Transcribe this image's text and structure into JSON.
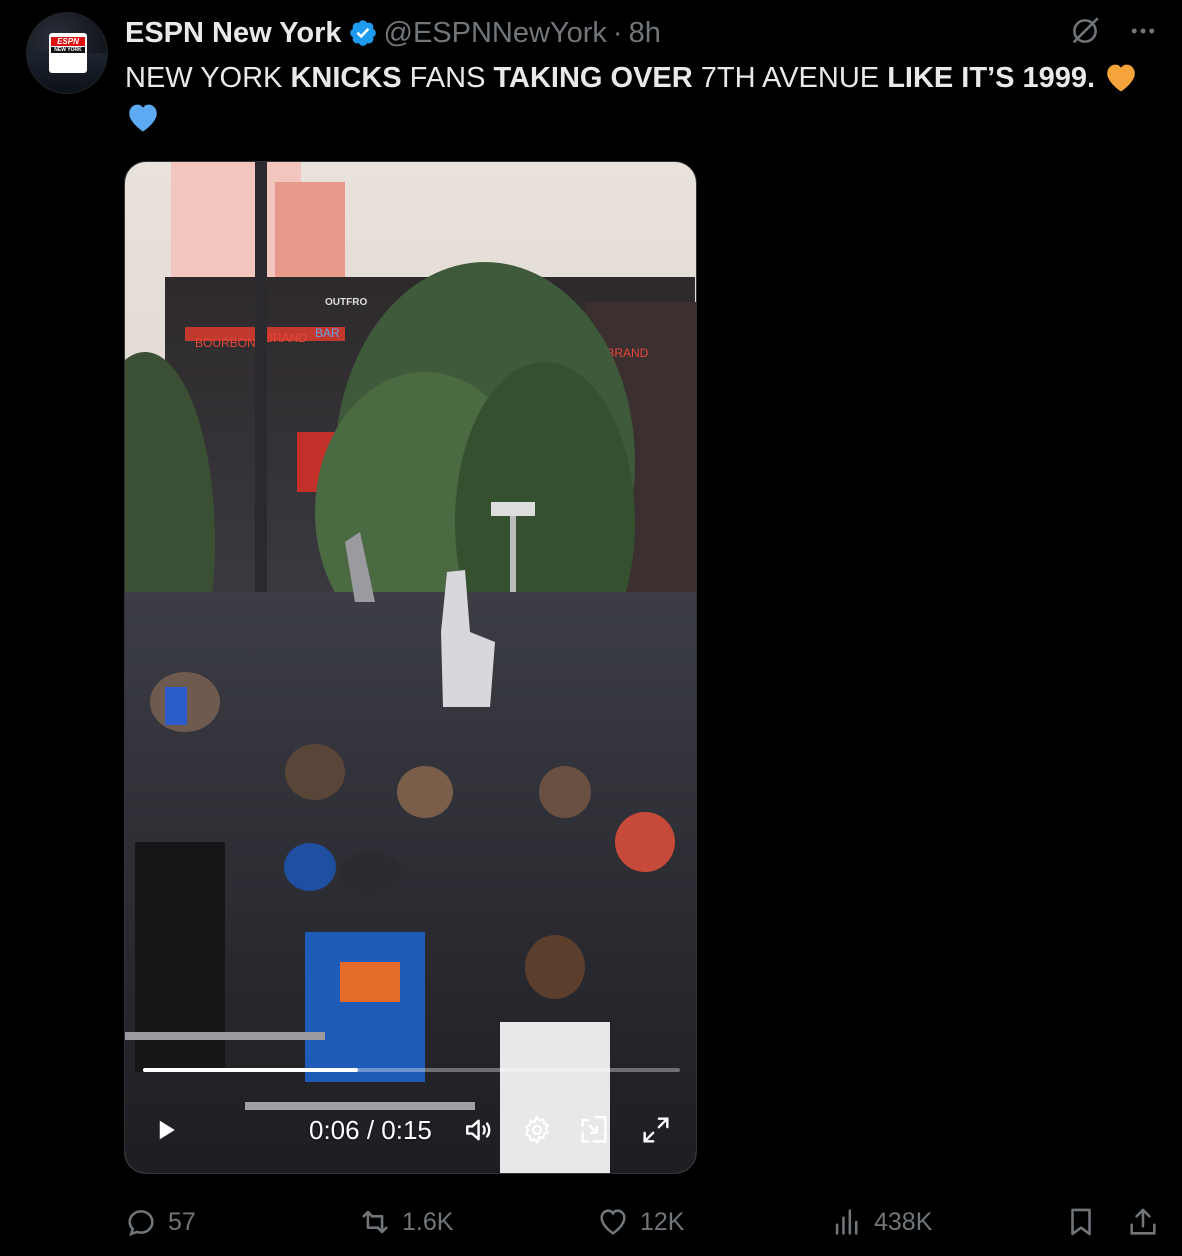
{
  "account": {
    "name": "ESPN New York",
    "handle": "@ESPNNewYork",
    "separator": "·",
    "time": "8h",
    "avatar_brand": "ESPN",
    "avatar_sub": "NEW YORK"
  },
  "tweet": {
    "segments": [
      {
        "text": "NEW YORK ",
        "bold": false
      },
      {
        "text": "KNICKS",
        "bold": true
      },
      {
        "text": " FANS ",
        "bold": false
      },
      {
        "text": "TAKING OVER",
        "bold": true
      },
      {
        "text": " 7TH AVENUE ",
        "bold": false
      },
      {
        "text": "LIKE IT’S 1999.",
        "bold": true
      }
    ],
    "emoji": [
      "orange-heart",
      "blue-heart"
    ]
  },
  "video": {
    "current_time": "0:06",
    "separator": " / ",
    "duration": "0:15",
    "progress": 0.4,
    "scene_signs": {
      "sign_1": "OUTFRO",
      "sign_2": "BOURBON",
      "sign_3": "BRAND",
      "sign_4": "BAR",
      "sign_5": "& BRAND"
    }
  },
  "actions": {
    "replies": "57",
    "reposts": "1.6K",
    "likes": "12K",
    "views": "438K"
  },
  "colors": {
    "background": "#000000",
    "text": "#e7e9ea",
    "muted": "#71767b",
    "verified": "#1d9bf0",
    "orange_heart": "#f4a43a",
    "blue_heart": "#5da9f2"
  }
}
